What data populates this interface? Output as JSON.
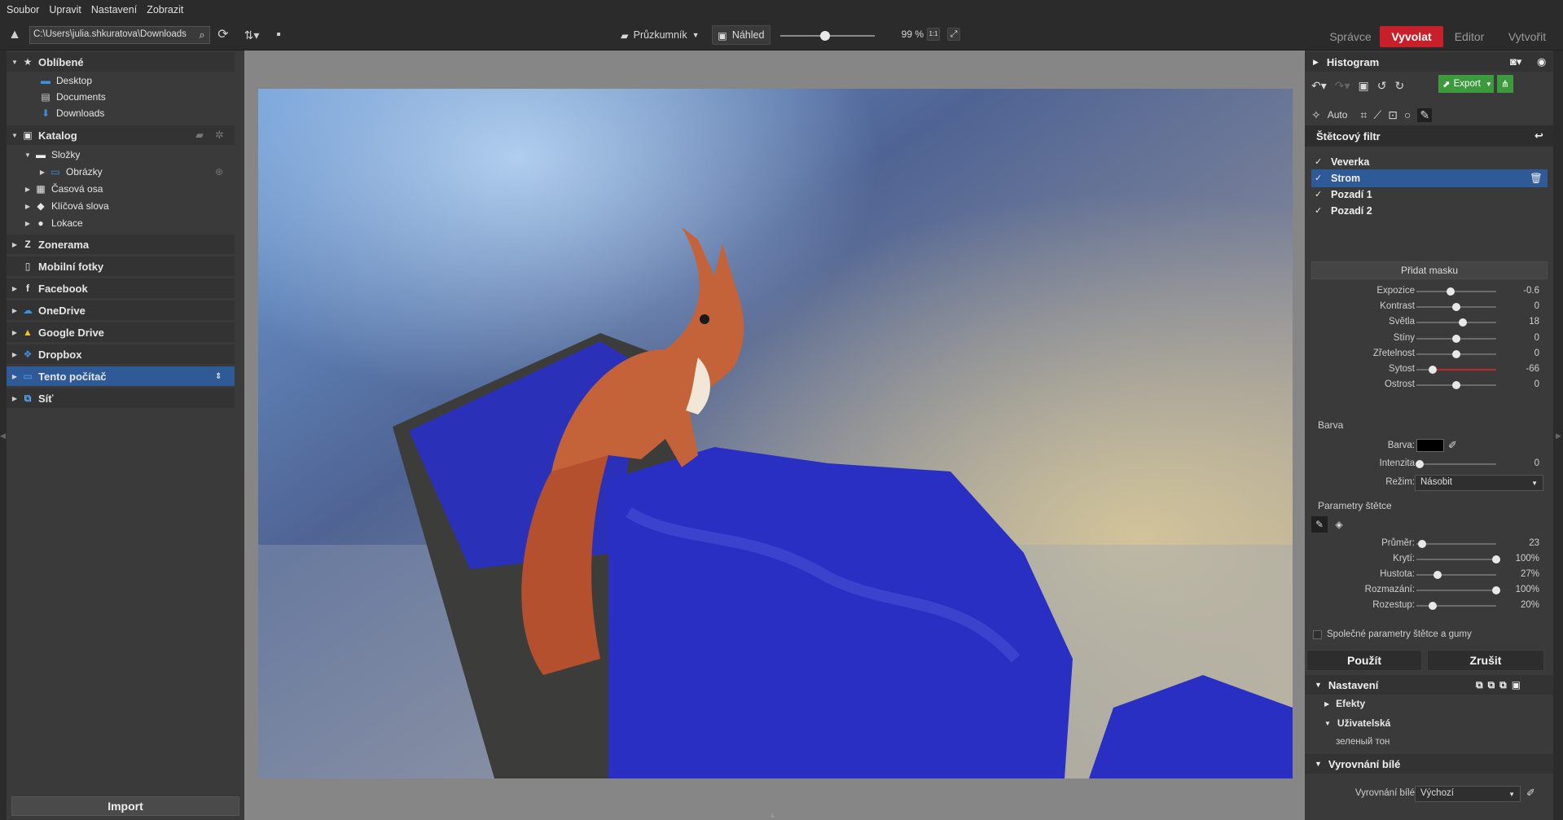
{
  "menu": [
    "Soubor",
    "Upravit",
    "Nastavení",
    "Zobrazit"
  ],
  "toolbar": {
    "path": "C:\\Users\\julia.shkuratova\\Downloads",
    "browser_label": "Průzkumník",
    "preview_label": "Náhled",
    "zoom": "99 %",
    "zoom_slider_fraction": 0.47,
    "modules": [
      "Správce",
      "Vyvolat",
      "Editor",
      "Vytvořit"
    ],
    "active_module": "Vyvolat"
  },
  "left": {
    "favorites": {
      "label": "Oblíbené",
      "items": [
        "Desktop",
        "Documents",
        "Downloads"
      ]
    },
    "catalog": {
      "label": "Katalog",
      "folders": "Složky",
      "pictures": "Obrázky",
      "timeline": "Časová osa",
      "keywords": "Klíčová slova",
      "locations": "Lokace"
    },
    "services": [
      "Zonerama",
      "Mobilní fotky",
      "Facebook",
      "OneDrive",
      "Google Drive",
      "Dropbox"
    ],
    "this_pc": "Tento počítač",
    "network": "Síť",
    "import_label": "Import"
  },
  "right": {
    "histogram": "Histogram",
    "export": "Export",
    "auto": "Auto",
    "filter_title": "Štětcový filtr",
    "masks": [
      {
        "label": "Veverka",
        "checked": true,
        "selected": false
      },
      {
        "label": "Strom",
        "checked": true,
        "selected": true
      },
      {
        "label": "Pozadí 1",
        "checked": true,
        "selected": false
      },
      {
        "label": "Pozadí 2",
        "checked": true,
        "selected": false
      }
    ],
    "add_mask": "Přidat masku",
    "adjust": [
      {
        "label": "Expozice",
        "value": "-0.6",
        "pos": 0.43
      },
      {
        "label": "Kontrast",
        "value": "0",
        "pos": 0.5
      },
      {
        "label": "Světla",
        "value": "18",
        "pos": 0.58
      },
      {
        "label": "Stíny",
        "value": "0",
        "pos": 0.5
      },
      {
        "label": "Zřetelnost",
        "value": "0",
        "pos": 0.5
      },
      {
        "label": "Sytost",
        "value": "-66",
        "pos": 0.2
      },
      {
        "label": "Ostrost",
        "value": "0",
        "pos": 0.5
      }
    ],
    "color_section": "Barva",
    "color_label": "Barva:",
    "intensity_label": "Intenzita",
    "intensity_value": "0",
    "mode_label": "Režim:",
    "mode_value": "Násobit",
    "brush_params": "Parametry štětce",
    "brush": [
      {
        "label": "Průměr:",
        "value": "23",
        "pos": 0.07
      },
      {
        "label": "Krytí:",
        "value": "100%",
        "pos": 1.0
      },
      {
        "label": "Hustota:",
        "value": "27%",
        "pos": 0.27
      },
      {
        "label": "Rozmazání:",
        "value": "100%",
        "pos": 1.0
      },
      {
        "label": "Rozestup:",
        "value": "20%",
        "pos": 0.2
      }
    ],
    "shared_params": "Společné parametry štětce a gumy",
    "apply": "Použít",
    "cancel": "Zrušit",
    "settings": "Nastavení",
    "effects": "Efekty",
    "user": "Uživatelská",
    "user_preset": "зеленый тон",
    "wb_section": "Vyrovnání bílé",
    "wb_label": "Vyrovnání bílé",
    "wb_value": "Výchozí"
  }
}
